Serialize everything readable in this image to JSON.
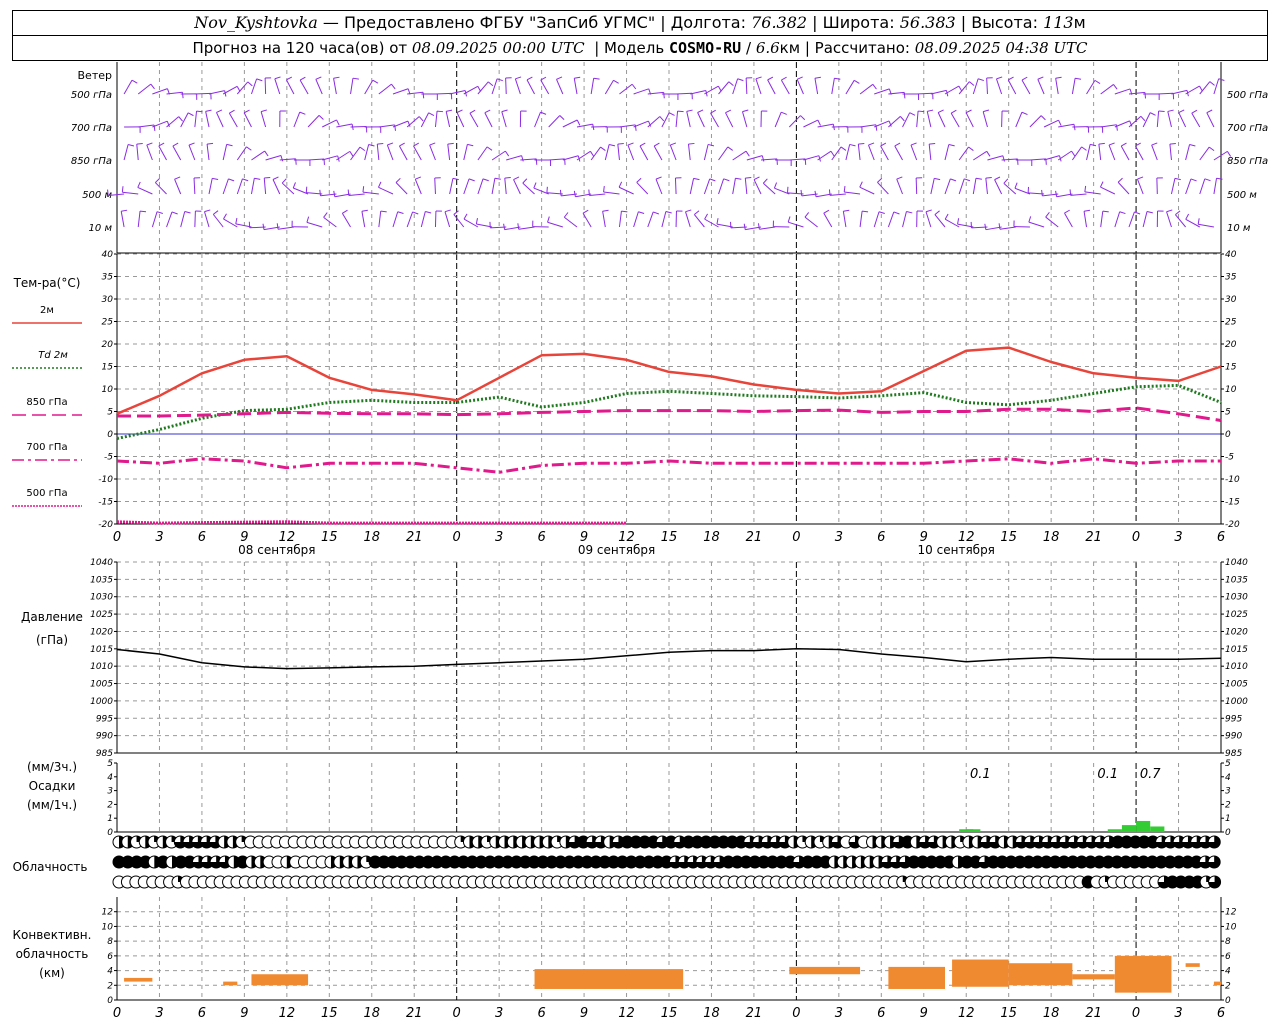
{
  "header": {
    "station": "Nov_Kyshtovka",
    "sep1": " — ",
    "provider": "Предоставлено ФГБУ \"ЗапСиб УГМС\"",
    "lon_label": "Долгота:",
    "lon_value": "76.382",
    "lat_label": "Широта:",
    "lat_value": "56.383",
    "alt_label": "Высота:",
    "alt_value": "113",
    "alt_unit": "м",
    "forecast_label": "Прогноз на 120 часа(ов) от",
    "forecast_date": "08.09.2025 00:00 UTC",
    "model_label": "Модель",
    "model_name": "COSMO-RU",
    "model_res": "6.6",
    "model_res_unit": "км",
    "calc_label": "Рассчитано:",
    "calc_date": "08.09.2025 04:38 UTC"
  },
  "colors": {
    "wind": "#8a2be2",
    "t2m": "#e8443a",
    "td2m": "#1f7a1f",
    "t850": "#e0198c",
    "t700": "#e0198c",
    "t500": "#e0198c",
    "pressure": "#000000",
    "precip": "#33cc33",
    "convective": "#f08a30",
    "grid": "#999999"
  },
  "chart_data": [
    {
      "type": "wind-barbs",
      "title": "Ветер",
      "levels": [
        "500 гПа",
        "700 гПа",
        "850 гПа",
        "500 м",
        "10 м"
      ]
    },
    {
      "type": "line",
      "title": "Тем-ра(°C)",
      "ylim": [
        -20,
        40
      ],
      "yticks": [
        -20,
        -15,
        -10,
        -5,
        0,
        5,
        10,
        15,
        20,
        25,
        30,
        35,
        40
      ],
      "x_hours": [
        0,
        3,
        6,
        9,
        12,
        15,
        18,
        21,
        24,
        27,
        30,
        33,
        36,
        39,
        42,
        45,
        48,
        51,
        54,
        57,
        60,
        63,
        66,
        69,
        72,
        75,
        78
      ],
      "series": [
        {
          "name": "2м",
          "key": "t2m",
          "style": "solid",
          "values": [
            4.5,
            8.5,
            13.5,
            16.5,
            17.3,
            12.5,
            9.8,
            8.8,
            7.5,
            12.5,
            17.5,
            17.8,
            16.5,
            13.8,
            12.8,
            11.0,
            9.8,
            9.0,
            9.5,
            14.0,
            18.5,
            19.2,
            16.0,
            13.5,
            12.5,
            11.8,
            15.0
          ]
        },
        {
          "name": "Td 2м",
          "key": "td2m",
          "style": "dotted",
          "values": [
            -1.0,
            1.0,
            3.5,
            5.2,
            5.5,
            7.0,
            7.5,
            7.0,
            7.0,
            8.2,
            6.0,
            7.0,
            9.0,
            9.5,
            9.0,
            8.5,
            8.3,
            8.0,
            8.5,
            9.2,
            7.0,
            6.5,
            7.5,
            9.0,
            10.5,
            10.8,
            7.0
          ]
        },
        {
          "name": "850 гПа",
          "key": "t850",
          "style": "dash",
          "values": [
            4.0,
            4.0,
            4.2,
            4.5,
            4.8,
            4.6,
            4.5,
            4.5,
            4.3,
            4.5,
            4.8,
            5.0,
            5.2,
            5.2,
            5.2,
            5.0,
            5.2,
            5.3,
            4.8,
            5.0,
            5.0,
            5.5,
            5.5,
            5.0,
            5.8,
            4.5,
            3.0
          ]
        },
        {
          "name": "700 гПа",
          "key": "t700",
          "style": "dashdot",
          "values": [
            -6.0,
            -6.5,
            -5.5,
            -6.0,
            -7.5,
            -6.5,
            -6.5,
            -6.5,
            -7.5,
            -8.5,
            -7.0,
            -6.5,
            -6.5,
            -6.0,
            -6.5,
            -6.5,
            -6.5,
            -6.5,
            -6.5,
            -6.5,
            -6.0,
            -5.5,
            -6.5,
            -5.5,
            -6.5,
            -6.0,
            -6.0
          ]
        },
        {
          "name": "500 гПа",
          "key": "t500",
          "style": "dense-dots",
          "values": [
            -19.5,
            -19.8,
            -19.7,
            -19.6,
            -19.5,
            -19.8,
            -19.8,
            -19.8,
            -19.8,
            -19.8,
            -19.8,
            -19.8,
            -19.8,
            null,
            null,
            null,
            null,
            null,
            null,
            null,
            null,
            null,
            null,
            null,
            null,
            null,
            null
          ]
        }
      ]
    },
    {
      "type": "line",
      "title": "Давление",
      "ylabel": "(гПа)",
      "ylim": [
        985,
        1040
      ],
      "yticks": [
        985,
        990,
        995,
        1000,
        1005,
        1010,
        1015,
        1020,
        1025,
        1030,
        1035,
        1040
      ],
      "x_hours": [
        0,
        3,
        6,
        9,
        12,
        15,
        18,
        21,
        24,
        27,
        30,
        33,
        36,
        39,
        42,
        45,
        48,
        51,
        54,
        57,
        60,
        63,
        66,
        69,
        72,
        75,
        78
      ],
      "series": [
        {
          "name": "Давление",
          "key": "pressure",
          "values": [
            1014.8,
            1013.5,
            1011.0,
            1009.8,
            1009.3,
            1009.5,
            1009.8,
            1010.0,
            1010.5,
            1011.0,
            1011.5,
            1012.0,
            1013.0,
            1014.0,
            1014.5,
            1014.5,
            1015.0,
            1014.8,
            1013.5,
            1012.5,
            1011.3,
            1012.0,
            1012.5,
            1012.0,
            1012.0,
            1012.0,
            1012.3
          ]
        }
      ]
    },
    {
      "type": "bar",
      "title": "Осадки",
      "ylabel_top": "(мм/3ч.)",
      "ylabel_bottom": "(мм/1ч.)",
      "ylim": [
        0,
        5
      ],
      "yticks": [
        0,
        1,
        2,
        3,
        4,
        5
      ],
      "annotations": [
        {
          "hour": 61,
          "text": "0.1"
        },
        {
          "hour": 70,
          "text": "0.1"
        },
        {
          "hour": 73,
          "text": "0.7"
        }
      ],
      "bars": [
        {
          "hour": 60,
          "value": 0.2
        },
        {
          "hour": 60.5,
          "value": 0.2
        },
        {
          "hour": 70.5,
          "value": 0.2
        },
        {
          "hour": 71.5,
          "value": 0.5
        },
        {
          "hour": 72.5,
          "value": 0.8
        },
        {
          "hour": 73.5,
          "value": 0.4
        }
      ]
    },
    {
      "type": "symbols",
      "title": "Облачность",
      "rows": [
        {
          "key": "upper",
          "values": [
            0.5,
            0.5,
            0.25,
            0.5,
            0.25,
            0.5,
            0.25,
            0.75,
            0.75,
            0.75,
            0.75,
            0.75,
            0.5,
            0.5,
            0.25,
            0,
            0,
            0,
            0,
            0,
            0,
            0,
            0,
            0,
            0,
            0,
            0,
            0,
            0,
            0,
            0,
            0,
            0,
            0,
            0,
            0,
            0,
            0,
            0,
            0.25,
            0.5,
            0.5,
            0.25,
            0.5,
            0.5,
            0.5,
            0.5,
            0.5,
            0.5,
            0.5,
            0.25,
            0.5,
            0.75,
            1,
            0.75,
            0.75,
            0.5,
            0.75,
            1,
            1,
            1,
            1,
            0.75,
            1,
            0.75,
            1,
            1,
            1,
            1,
            1,
            1,
            1,
            0.75,
            0.75,
            0.75,
            0.75,
            0.75,
            0.5,
            0.25,
            0.5,
            0.25,
            0.5,
            0.75,
            0,
            0.75,
            0,
            0.5,
            0.5,
            0.5,
            0.75,
            1,
            0.5,
            0.75,
            0.75,
            0.5,
            0.5,
            0.25,
            0.5,
            0.5,
            0.75,
            0.75,
            0.5,
            0.5,
            0.75,
            0.75,
            0.75,
            0.75,
            0.75,
            0.75,
            0.75,
            0.75,
            0.75,
            0.75,
            0.75,
            1,
            1,
            1,
            1,
            1,
            0.75,
            0.75,
            0.75,
            0.75,
            0.75,
            0.75,
            0.75
          ]
        },
        {
          "key": "middle",
          "values": [
            1,
            1,
            1,
            1,
            0.5,
            1,
            0.5,
            1,
            1,
            0.75,
            0.75,
            0.75,
            0.75,
            0.5,
            1,
            0.5,
            0.5,
            0,
            0,
            0.5,
            0,
            0,
            0,
            0,
            0.5,
            0.5,
            0.5,
            0.5,
            0.25,
            1,
            1,
            1,
            1,
            1,
            1,
            1,
            1,
            1,
            1,
            1,
            1,
            1,
            1,
            1,
            1,
            1,
            1,
            1,
            1,
            1,
            1,
            1,
            1,
            1,
            1,
            1,
            1,
            1,
            1,
            1,
            1,
            1,
            1,
            0.75,
            0.75,
            0.75,
            0.75,
            0.75,
            0.75,
            1,
            1,
            1,
            1,
            1,
            1,
            1,
            1,
            0.75,
            1,
            1,
            1,
            0.5,
            0.5,
            0.5,
            0.5,
            0.5,
            0.5,
            0.75,
            0.75,
            0.75,
            1,
            1,
            1,
            1,
            1,
            0.5,
            1,
            1,
            0.75,
            1,
            1,
            1,
            1,
            1,
            1,
            1,
            1,
            1,
            1,
            1,
            1,
            1,
            1,
            1,
            1,
            1,
            1,
            1,
            1,
            1,
            1,
            1,
            1,
            0.75,
            0.75
          ]
        },
        {
          "key": "lower",
          "values": [
            0,
            0,
            0,
            0,
            0,
            0,
            0,
            0.25,
            0,
            0,
            0,
            0,
            0,
            0,
            0,
            0,
            0,
            0,
            0,
            0,
            0,
            0,
            0,
            0,
            0,
            0,
            0,
            0,
            0,
            0,
            0,
            0,
            0,
            0,
            0,
            0,
            0,
            0,
            0,
            0,
            0,
            0,
            0,
            0,
            0,
            0,
            0,
            0,
            0,
            0,
            0,
            0,
            0,
            0,
            0,
            0,
            0,
            0,
            0,
            0,
            0,
            0,
            0,
            0,
            0,
            0,
            0,
            0,
            0,
            0,
            0,
            0,
            0,
            0,
            0,
            0,
            0,
            0,
            0,
            0,
            0,
            0,
            0,
            0,
            0,
            0,
            0,
            0,
            0,
            0,
            0,
            0,
            0,
            0.25,
            0,
            0,
            0,
            0,
            0,
            0,
            0,
            0,
            0,
            0,
            0,
            0,
            0,
            0,
            0,
            0,
            0,
            0,
            0,
            0,
            0,
            1,
            0,
            0.25,
            0,
            0,
            0,
            0,
            0,
            0,
            0.75,
            1,
            1,
            1,
            1,
            0.25,
            0.75
          ]
        }
      ]
    },
    {
      "type": "bar",
      "title": "Конвективн. облачность",
      "ylabel": "(км)",
      "ylim": [
        0,
        14
      ],
      "yticks": [
        0,
        2,
        4,
        6,
        8,
        10,
        12
      ],
      "bars": [
        {
          "h0": 0.5,
          "h1": 2.5,
          "base": 2.5,
          "top": 3.0
        },
        {
          "h0": 7.5,
          "h1": 8.5,
          "base": 2.0,
          "top": 2.5
        },
        {
          "h0": 9.5,
          "h1": 13.5,
          "base": 2.0,
          "top": 3.5
        },
        {
          "h0": 29.5,
          "h1": 40.0,
          "base": 1.5,
          "top": 4.2
        },
        {
          "h0": 47.5,
          "h1": 52.5,
          "base": 3.5,
          "top": 4.5
        },
        {
          "h0": 54.5,
          "h1": 58.5,
          "base": 1.5,
          "top": 4.5
        },
        {
          "h0": 59.0,
          "h1": 63.0,
          "base": 1.8,
          "top": 5.5
        },
        {
          "h0": 63.0,
          "h1": 67.5,
          "base": 2.0,
          "top": 5.0
        },
        {
          "h0": 67.5,
          "h1": 70.5,
          "base": 2.8,
          "top": 3.5
        },
        {
          "h0": 70.5,
          "h1": 74.5,
          "base": 1.0,
          "top": 6.0
        },
        {
          "h0": 75.5,
          "h1": 76.5,
          "base": 4.5,
          "top": 5.0
        },
        {
          "h0": 77.5,
          "h1": 78.0,
          "base": 2.0,
          "top": 2.5
        }
      ]
    }
  ],
  "axis": {
    "hour_labels": [
      "0",
      "3",
      "6",
      "9",
      "12",
      "15",
      "18",
      "21",
      "0",
      "3",
      "6",
      "9",
      "12",
      "15",
      "18",
      "21",
      "0",
      "3",
      "6",
      "9",
      "12",
      "15",
      "18",
      "21",
      "0",
      "3",
      "6"
    ],
    "date_labels": [
      "08 сентября",
      "09 сентября",
      "10 сентября"
    ]
  }
}
